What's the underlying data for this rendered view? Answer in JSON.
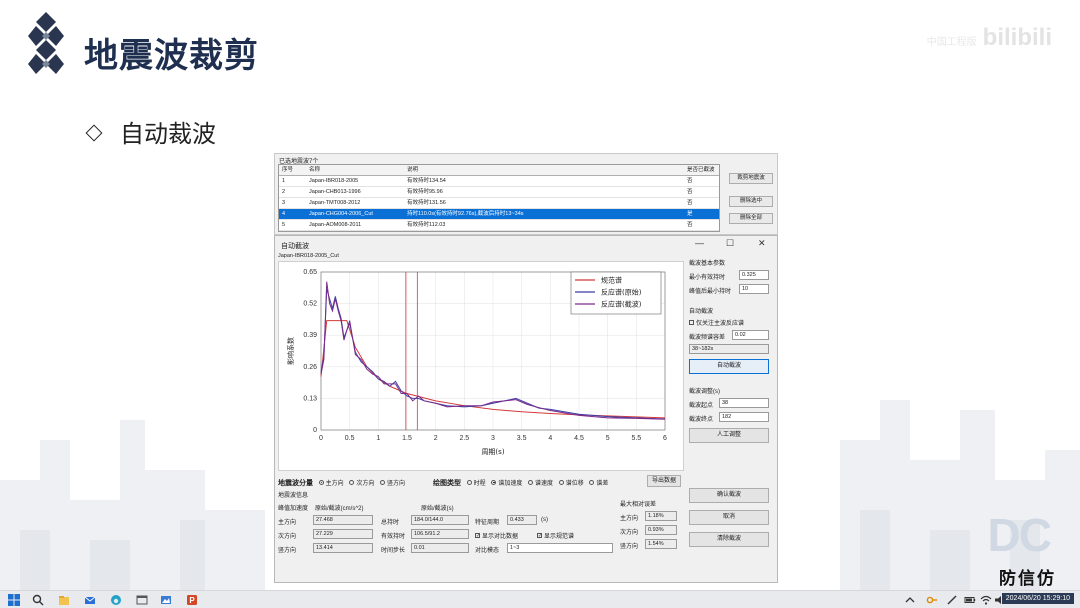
{
  "slide": {
    "title": "地震波裁剪",
    "bullet": "自动裁波",
    "watermark": {
      "small": "中国工程版",
      "brand": "bilibili"
    },
    "brand_text": "防信仿",
    "dc_letters": "DC"
  },
  "top_window": {
    "caption": "已选地震波7个",
    "headers": [
      "序号",
      "名称",
      "说明",
      "是否已截波"
    ],
    "rows": [
      {
        "n": "1",
        "name": "Japan-IBR018-2005",
        "desc": "有效持时134.54",
        "cut": "否"
      },
      {
        "n": "2",
        "name": "Japan-CHB013-1996",
        "desc": "有效持时95.96",
        "cut": "否"
      },
      {
        "n": "3",
        "name": "Japan-TMT008-2012",
        "desc": "有效持时131.56",
        "cut": "否"
      },
      {
        "n": "4",
        "name": "Japan-CHG004-2006_Cut",
        "desc": "持时110.0s(有效持时92.76s),截波后持时13~34s",
        "cut": "是"
      },
      {
        "n": "5",
        "name": "Japan-AOM008-2011",
        "desc": "有效持时112.03",
        "cut": "否"
      }
    ],
    "side_buttons": [
      "裁剪地震波",
      "删除选中",
      "删除全部"
    ]
  },
  "window": {
    "title": "自动截波",
    "controls": [
      "—",
      "☐",
      "✕"
    ],
    "file": "Japan-IBR018-2005_Cut",
    "params": {
      "section": "截波基本参数",
      "min_eff_label": "最小有效持时",
      "min_eff_value": "0.325",
      "min_after_label": "峰值后最小持时",
      "min_after_value": "10"
    },
    "auto": {
      "section": "自动截波",
      "check_label": "仅关注主波反应谱",
      "tol_label": "截波频谱容差",
      "tol_value": "0.02",
      "range_value": "38~182s",
      "button": "自动截波"
    },
    "adjust": {
      "section": "截波调整(s)",
      "start_label": "截波起点",
      "start_value": "38",
      "end_label": "截波终点",
      "end_value": "182",
      "button": "人工调整"
    },
    "component": {
      "label": "地震波分量",
      "options": [
        "主方向",
        "次方向",
        "竖方向"
      ],
      "selected": 0
    },
    "plot_type": {
      "label": "绘图类型",
      "options": [
        "时程",
        "谱加速度",
        "谱速度",
        "谱位移",
        "谱差"
      ],
      "selected": 1
    },
    "export_button": "导出数据",
    "info": {
      "section": "地震波信息",
      "peak_acc_label": "峰值加速度",
      "unit_acc": "原始/截波(cm/s^2)",
      "unit_time": "原始/截波(s)",
      "dir_labels": [
        "主方向",
        "次方向",
        "竖方向"
      ],
      "peak_values": [
        "27.468",
        "27.229",
        "13.414"
      ],
      "total_label": "总持时",
      "total_value": "184.0/144.0",
      "eff_label": "有效持时",
      "eff_value": "106.5/91.2",
      "step_label": "时间步长",
      "step_value": "0.01",
      "period_label": "特征周期",
      "period_value": "0.433",
      "period_unit": "(s)",
      "show_compare": "显示对比数据",
      "show_code": "显示规范谱",
      "compare_mode_label": "对比模态",
      "compare_mode_value": "1~3",
      "err_section": "最大相对误差",
      "err_values": [
        "1.18%",
        "0.93%",
        "1.54%"
      ]
    },
    "bottom_buttons": [
      "确认截波",
      "取消",
      "清除截波"
    ]
  },
  "chart_data": {
    "type": "line",
    "xlabel": "周期(s)",
    "ylabel": "影响系数",
    "xlim": [
      0,
      6
    ],
    "ylim": [
      0,
      0.65
    ],
    "xticks": [
      "0",
      "0.5",
      "1",
      "1.5",
      "2",
      "2.5",
      "3",
      "3.5",
      "4",
      "4.5",
      "5",
      "5.5",
      "6"
    ],
    "yticks": [
      "0",
      "0.13",
      "0.26",
      "0.39",
      "0.52",
      "0.65"
    ],
    "legend_position": "top-right",
    "colors": {
      "code": "#d23a3a",
      "orig": "#3b3fa6",
      "cut": "#7a2a8a"
    },
    "vlines": [
      1.48,
      1.68
    ],
    "series": [
      {
        "name": "规范谱",
        "x": [
          0,
          0.1,
          0.45,
          0.6,
          0.8,
          1.0,
          1.2,
          1.5,
          2.0,
          2.5,
          3.0,
          3.5,
          4.0,
          4.5,
          5.0,
          5.5,
          6.0
        ],
        "y": [
          0.22,
          0.45,
          0.45,
          0.34,
          0.26,
          0.21,
          0.18,
          0.15,
          0.12,
          0.1,
          0.085,
          0.075,
          0.068,
          0.062,
          0.058,
          0.054,
          0.05
        ]
      },
      {
        "name": "反应谱(原始)",
        "x": [
          0,
          0.05,
          0.1,
          0.15,
          0.2,
          0.25,
          0.3,
          0.35,
          0.4,
          0.5,
          0.6,
          0.7,
          0.8,
          0.9,
          1.0,
          1.1,
          1.2,
          1.3,
          1.4,
          1.5,
          1.6,
          1.7,
          1.8,
          2.0,
          2.2,
          2.5,
          2.8,
          3.0,
          3.2,
          3.4,
          3.6,
          3.8,
          4.0,
          4.5,
          5.0,
          5.5,
          6.0
        ],
        "y": [
          0.24,
          0.3,
          0.58,
          0.54,
          0.5,
          0.55,
          0.5,
          0.46,
          0.38,
          0.44,
          0.32,
          0.28,
          0.26,
          0.24,
          0.21,
          0.2,
          0.18,
          0.2,
          0.16,
          0.14,
          0.13,
          0.13,
          0.12,
          0.11,
          0.1,
          0.095,
          0.1,
          0.11,
          0.12,
          0.13,
          0.11,
          0.09,
          0.085,
          0.065,
          0.055,
          0.05,
          0.045
        ]
      },
      {
        "name": "反应谱(截波)",
        "x": [
          0,
          0.05,
          0.1,
          0.15,
          0.2,
          0.25,
          0.3,
          0.35,
          0.4,
          0.5,
          0.6,
          0.7,
          0.8,
          0.9,
          1.0,
          1.1,
          1.2,
          1.3,
          1.4,
          1.5,
          1.6,
          1.7,
          1.8,
          2.0,
          2.2,
          2.5,
          2.8,
          3.0,
          3.2,
          3.4,
          3.6,
          3.8,
          4.0,
          4.5,
          5.0,
          5.5,
          6.0
        ],
        "y": [
          0.23,
          0.29,
          0.61,
          0.52,
          0.49,
          0.54,
          0.49,
          0.45,
          0.37,
          0.45,
          0.31,
          0.29,
          0.25,
          0.23,
          0.22,
          0.19,
          0.19,
          0.19,
          0.15,
          0.15,
          0.12,
          0.14,
          0.12,
          0.11,
          0.095,
          0.1,
          0.1,
          0.115,
          0.12,
          0.125,
          0.105,
          0.092,
          0.08,
          0.06,
          0.05,
          0.048,
          0.044
        ]
      }
    ]
  },
  "taskbar": {
    "datetime": "2024/06/20 15:29:10"
  }
}
